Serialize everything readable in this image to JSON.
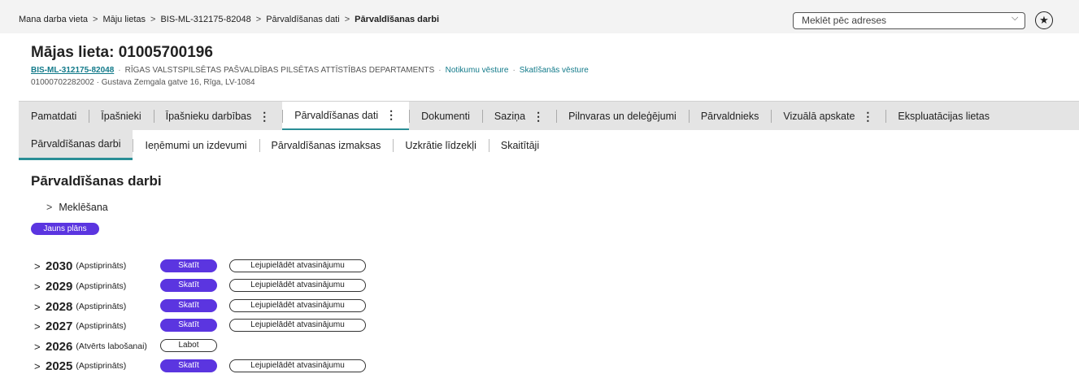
{
  "breadcrumb": {
    "items": [
      "Mana darba vieta",
      "Māju lietas",
      "BIS-ML-312175-82048",
      "Pārvaldīšanas dati"
    ],
    "current": "Pārvaldīšanas darbi",
    "separator": ">"
  },
  "header": {
    "title": "Mājas lieta: 01005700196",
    "case_code": "BIS-ML-312175-82048",
    "department": "RĪGAS VALSTSPILSĒTAS PAŠVALDĪBAS PILSĒTAS ATTĪSTĪBAS DEPARTAMENTS",
    "link_history": "Notikumu vēsture",
    "link_views": "Skatīšanās vēsture",
    "dot": "·",
    "address_line": "01000702282002 · Gustava Zemgala gatve 16, Rīga, LV-1084"
  },
  "search": {
    "placeholder": "Meklēt pēc adreses",
    "chevron": "⌵"
  },
  "favorite": {
    "icon": "★"
  },
  "main_tabs": [
    {
      "label": "Pamatdati"
    },
    {
      "label": "Īpašnieki"
    },
    {
      "label": "Īpašnieku darbības",
      "menu": "⋮"
    },
    {
      "label": "Pārvaldīšanas dati",
      "menu": "⋮"
    },
    {
      "label": "Dokumenti"
    },
    {
      "label": "Saziņa",
      "menu": "⋮"
    },
    {
      "label": "Pilnvaras un deleģējumi"
    },
    {
      "label": "Pārvaldnieks"
    },
    {
      "label": "Vizuālā apskate",
      "menu": "⋮"
    },
    {
      "label": "Ekspluatācijas lietas"
    }
  ],
  "sub_tabs": [
    {
      "label": "Pārvaldīšanas darbi"
    },
    {
      "label": "Ieņēmumi un izdevumi"
    },
    {
      "label": "Pārvaldīšanas izmaksas"
    },
    {
      "label": "Uzkrātie līdzekļi"
    },
    {
      "label": "Skaitītāji"
    }
  ],
  "section": {
    "title": "Pārvaldīšanas darbi",
    "search_toggle": "Meklēšana",
    "new_plan_button": "Jauns plāns",
    "chevron": ">"
  },
  "plans": [
    {
      "year": "2030",
      "status": "(Apstiprināts)",
      "view": "Skatīt",
      "download": "Lejupielādēt atvasinājumu"
    },
    {
      "year": "2029",
      "status": "(Apstiprināts)",
      "view": "Skatīt",
      "download": "Lejupielādēt atvasinājumu"
    },
    {
      "year": "2028",
      "status": "(Apstiprināts)",
      "view": "Skatīt",
      "download": "Lejupielādēt atvasinājumu"
    },
    {
      "year": "2027",
      "status": "(Apstiprināts)",
      "view": "Skatīt",
      "download": "Lejupielādēt atvasinājumu"
    },
    {
      "year": "2026",
      "status": "(Atvērts labošanai)",
      "edit": "Labot"
    },
    {
      "year": "2025",
      "status": "(Apstiprināts)",
      "view": "Skatīt",
      "download": "Lejupielādēt atvasinājumu"
    }
  ],
  "colors": {
    "accent": "#2a8e96",
    "primary_button": "#5b35e0",
    "link": "#127a8a"
  }
}
